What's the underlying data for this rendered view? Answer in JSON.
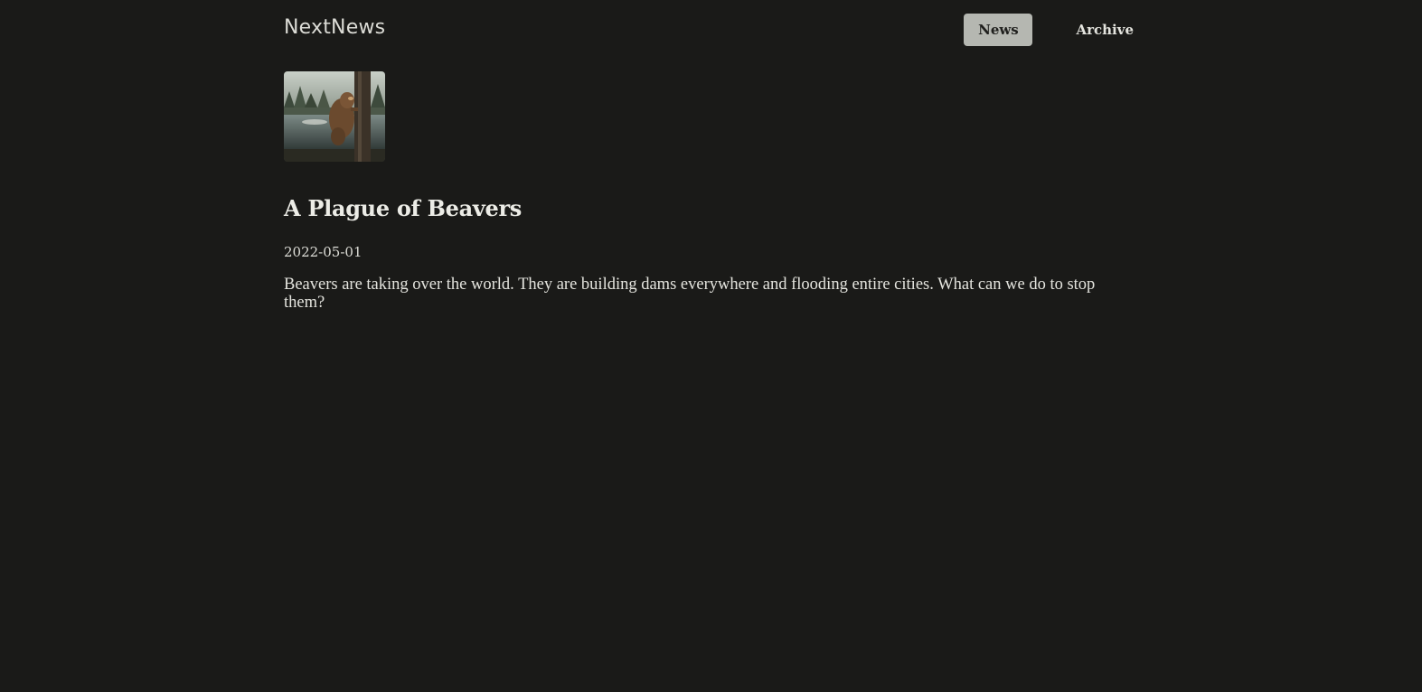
{
  "header": {
    "brand": "NextNews",
    "nav": [
      {
        "label": "News",
        "active": true
      },
      {
        "label": "Archive",
        "active": false
      }
    ]
  },
  "article": {
    "image_icon": "beaver-photo",
    "title": "A Plague of Beavers",
    "date": "2022-05-01",
    "body": "Beavers are taking over the world. They are building dams everywhere and flooding entire cities. What can we do to stop them?"
  },
  "colors": {
    "background": "#1a1a18",
    "text": "#e4e4de",
    "nav_active_bg": "#b5b7b1"
  }
}
